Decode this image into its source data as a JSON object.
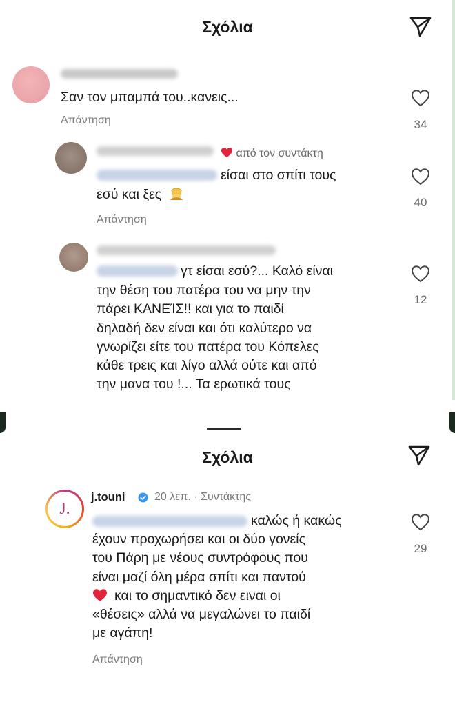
{
  "screen1": {
    "title": "Σχόλια",
    "comments": [
      {
        "text": "Σαν τον μπαμπά του..κανεις...",
        "reply": "Απάντηση",
        "likes": "34"
      },
      {
        "badge": "από τον συντάκτη",
        "text_line1": "είσαι στο σπίτι τους",
        "text_line2": "εσύ και ξες",
        "reply": "Απάντηση",
        "likes": "40"
      },
      {
        "text_line1": "γτ είσαι εσύ?... Καλό είναι",
        "text_lines": [
          "την θέση του πατέρα του να μην την",
          "πάρει ΚΑΝΕΊΣ!! και για το παιδί",
          "δηλαδή δεν είναι και ότι καλύτερο να",
          "γνωρίζει είτε του πατέρα του Κόπελες",
          "κάθε τρεις και λίγο αλλά ούτε και από",
          "την μανα του !... Τα ερωτικά τους"
        ],
        "likes": "12"
      }
    ]
  },
  "screen2": {
    "title": "Σχόλια",
    "comment": {
      "avatar_letter": "J.",
      "username": "j.touni",
      "meta": "20 λεπ. · Συντάκτης",
      "text_line1": "καλώς ή κακώς",
      "text_lines": [
        "έχουν προχωρήσει και οι δύο γονείς",
        "του Πάρη με νέους συντρόφους που",
        "είναι μαζί όλη μέρα σπίτι και παντού",
        "και το σημαντικό δεν ειναι οι",
        "«θέσεις» αλλά να μεγαλώνει το παιδί",
        "με αγάπη!"
      ],
      "reply": "Απάντηση",
      "likes": "29"
    }
  },
  "icons": {
    "send": "send-icon",
    "like": "heart-outline-icon",
    "verified": "verified-badge-icon",
    "heart_red": "heart-red-icon",
    "emoji": "facepalm-emoji-icon"
  },
  "colors": {
    "author_heart": "#e0243b",
    "verified": "#3797f0",
    "avatar_ring_start": "#f6b21b",
    "avatar_ring_end": "#c3348a",
    "avatar_letter": "#b5366f"
  }
}
